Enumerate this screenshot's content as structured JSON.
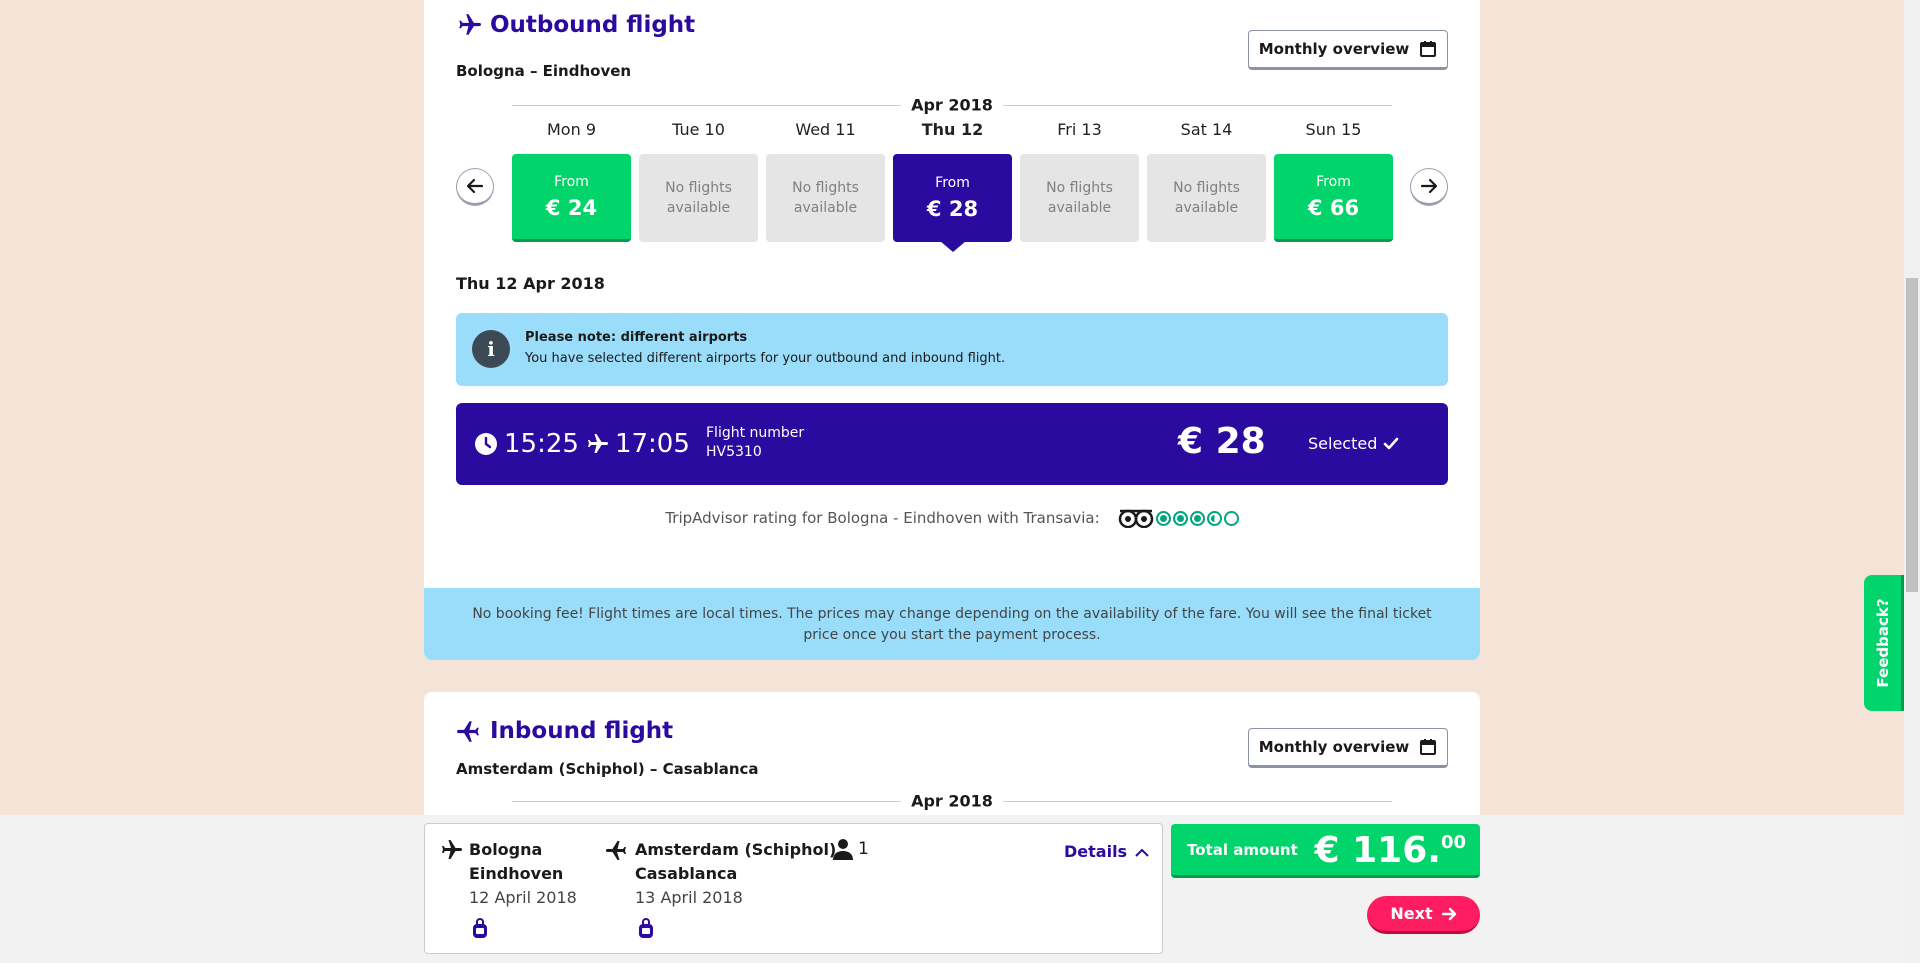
{
  "outbound": {
    "title": "Outbound flight",
    "route": "Bologna – Eindhoven",
    "monthly_btn": "Monthly overview",
    "month": "Apr 2018",
    "days": [
      {
        "name": "Mon 9",
        "line1": "From",
        "line2": "€ 24",
        "state": "green"
      },
      {
        "name": "Tue 10",
        "line1": "No flights",
        "line2": "available",
        "state": "grey"
      },
      {
        "name": "Wed 11",
        "line1": "No flights",
        "line2": "available",
        "state": "grey"
      },
      {
        "name": "Thu 12",
        "line1": "From",
        "line2": "€ 28",
        "state": "selected"
      },
      {
        "name": "Fri 13",
        "line1": "No flights",
        "line2": "available",
        "state": "grey"
      },
      {
        "name": "Sat 14",
        "line1": "No flights",
        "line2": "available",
        "state": "grey"
      },
      {
        "name": "Sun 15",
        "line1": "From",
        "line2": "€ 66",
        "state": "green"
      }
    ],
    "date_heading": "Thu 12 Apr 2018",
    "notice_title": "Please note: different airports",
    "notice_text": "You have selected different airports for your outbound and inbound flight.",
    "flight": {
      "depart": "15:25",
      "arrive": "17:05",
      "number_label": "Flight number",
      "number": "HV5310",
      "price": "€ 28",
      "selected_label": "Selected"
    },
    "tripadvisor": "TripAdvisor rating for Bologna - Eindhoven with Transavia:",
    "tripadvisor_rating": 3.5,
    "disclaimer": "No booking fee! Flight times are local times. The prices may change depending on the availability of the fare. You will see the final ticket price once you start the payment process."
  },
  "inbound": {
    "title": "Inbound flight",
    "route": "Amsterdam (Schiphol) – Casablanca",
    "monthly_btn": "Monthly overview",
    "month": "Apr 2018"
  },
  "summary": {
    "leg1": {
      "from": "Bologna",
      "to": "Eindhoven",
      "date": "12 April 2018"
    },
    "leg2": {
      "from": "Amsterdam (Schiphol)",
      "to": "Casablanca",
      "date": "13 April 2018"
    },
    "passengers": "1",
    "details": "Details",
    "total_label": "Total amount",
    "total_value": "€ 116.",
    "total_cents": "00",
    "next": "Next",
    "feedback": "Feedback?"
  },
  "colors": {
    "brand": "#2b0a9f",
    "green": "#00d46a",
    "pink": "#ff1d61",
    "info": "#99ddfa"
  }
}
